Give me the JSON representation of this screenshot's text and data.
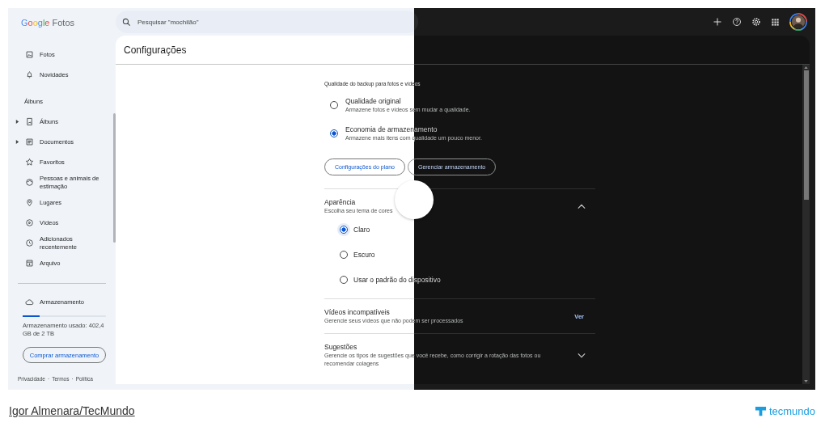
{
  "topbar": {
    "logo": "Google Fotos",
    "search": {
      "placeholder": "Pesquisar \"mochilão\""
    }
  },
  "sidebar": {
    "items": [
      {
        "kind": "item",
        "label": "Fotos"
      },
      {
        "kind": "item",
        "label": "Novidades"
      },
      {
        "kind": "heading",
        "label": "Álbuns"
      },
      {
        "kind": "group",
        "label": "Álbuns",
        "expanded": false
      },
      {
        "kind": "group",
        "label": "Documentos",
        "expanded": false
      },
      {
        "kind": "item",
        "label": "Favoritos"
      },
      {
        "kind": "item",
        "label": "Pessoas e animais de estimação"
      },
      {
        "kind": "item",
        "label": "Lugares"
      },
      {
        "kind": "item",
        "label": "Vídeos"
      },
      {
        "kind": "item",
        "label": "Adicionados recentemente"
      },
      {
        "kind": "item",
        "label": "Arquivo"
      }
    ],
    "storage": {
      "label": "Armazenamento",
      "level": 0.2,
      "usage": "Armazenamento usado: 402,4 GB de 2 TB",
      "button": "Comprar armazenamento"
    },
    "footer": {
      "links": [
        "Privacidade",
        "Termos",
        "Política"
      ],
      "separator": "·"
    }
  },
  "panel": {
    "title": "Configurações",
    "sections": [
      {
        "kind": "radio-group",
        "heading": "Qualidade do backup para fotos e vídeos",
        "options": [
          {
            "label": "Qualidade original",
            "description": "Armazene fotos e vídeos sem mudar a qualidade.",
            "selected": false
          },
          {
            "label": "Economia de armazenamento",
            "description": "Armazene mais itens com qualidade um pouco menor.",
            "selected": true
          }
        ],
        "buttons": [
          "Configurações do plano",
          "Gerenciar armazenamento"
        ]
      },
      {
        "kind": "expandable",
        "title": "Aparência",
        "description": "Escolha seu tema de cores",
        "expanded": true,
        "options": [
          {
            "label": "Claro",
            "selected": true
          },
          {
            "label": "Escuro",
            "selected": false
          },
          {
            "label": "Usar o padrão do dispositivo",
            "selected": false
          }
        ]
      },
      {
        "kind": "link",
        "title": "Vídeos incompatíveis",
        "description": "Gerencie seus vídeos que não podem ser processados",
        "action": "Ver"
      },
      {
        "kind": "expandable",
        "title": "Sugestões",
        "description": "Gerencie os tipos de sugestões que você recebe, como corrigir a rotação das fotos ou recomendar colagens",
        "expanded": false
      }
    ]
  },
  "caption": {
    "credit": "Igor Almenara/TecMundo",
    "brand": "tecmundo"
  }
}
